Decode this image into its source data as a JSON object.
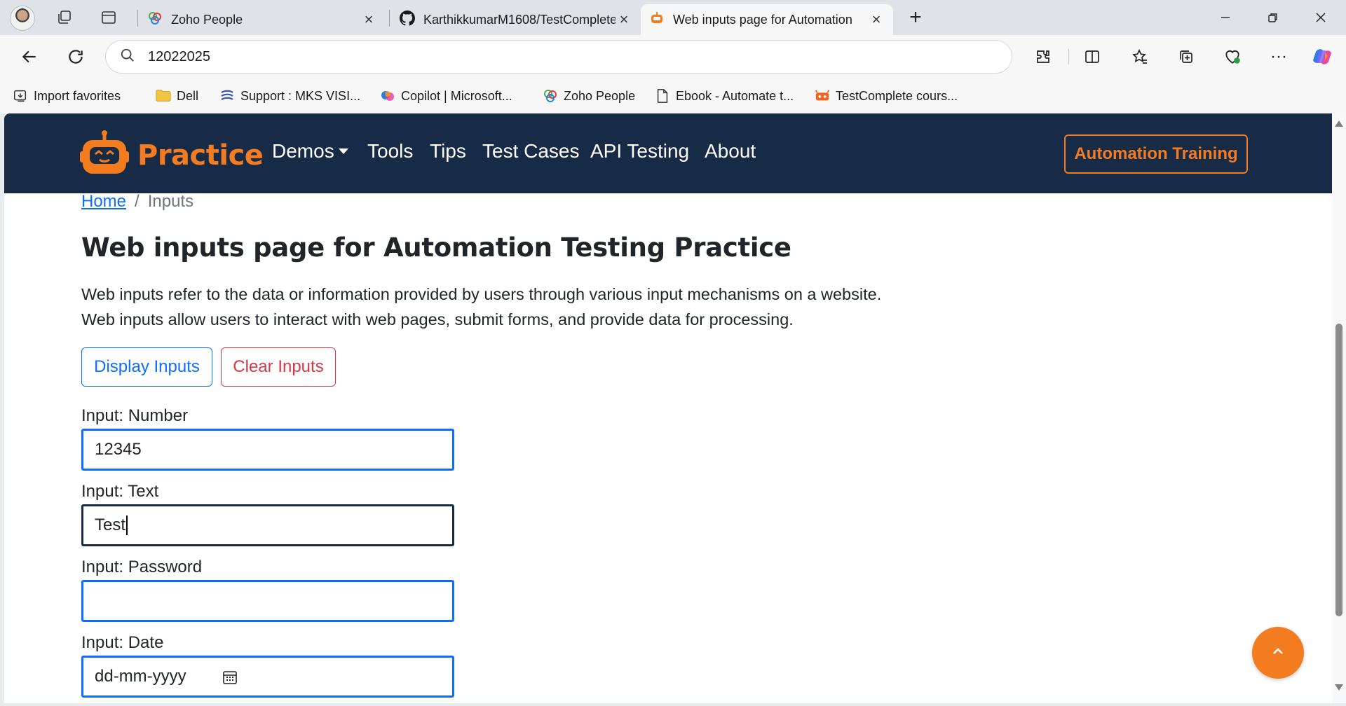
{
  "browser": {
    "tabs": [
      {
        "title": "Zoho People",
        "active": false
      },
      {
        "title": "KarthikkumarM1608/TestComplete",
        "active": false
      },
      {
        "title": "Web inputs page for Automation",
        "active": true
      }
    ],
    "new_tab_icon": "plus-icon",
    "address": "12022025",
    "favorites": [
      {
        "label": "Import favorites",
        "icon": "import-icon"
      },
      {
        "label": "Dell",
        "icon": "folder-icon"
      },
      {
        "label": "Support : MKS VISI...",
        "icon": "mks-logo-icon"
      },
      {
        "label": "Copilot | Microsoft...",
        "icon": "copilot-icon"
      },
      {
        "label": "Zoho People",
        "icon": "zoho-icon"
      },
      {
        "label": "Ebook - Automate t...",
        "icon": "page-icon"
      },
      {
        "label": "TestComplete cours...",
        "icon": "testcomplete-icon"
      }
    ]
  },
  "site": {
    "brand": "Practice",
    "nav": {
      "demos": "Demos",
      "tools": "Tools",
      "tips": "Tips",
      "test_cases": "Test Cases",
      "api_testing": "API Testing",
      "about": "About"
    },
    "cta": "Automation Training",
    "colors": {
      "navbar": "#172a46",
      "accent": "#f47c20",
      "primary": "#0d6efd",
      "danger": "#dc3545"
    }
  },
  "breadcrumb": {
    "home": "Home",
    "separator": "/",
    "current": "Inputs"
  },
  "main": {
    "title": "Web inputs page for Automation Testing Practice",
    "intro_line1": "Web inputs refer to the data or information provided by users through various input mechanisms on a website.",
    "intro_line2": "Web inputs allow users to interact with web pages, submit forms, and provide data for processing.",
    "display_button": "Display Inputs",
    "clear_button": "Clear Inputs",
    "fields": {
      "number": {
        "label": "Input: Number",
        "value": "12345"
      },
      "text": {
        "label": "Input: Text",
        "value": "Test"
      },
      "password": {
        "label": "Input: Password",
        "value": ""
      },
      "date": {
        "label": "Input: Date",
        "placeholder": "dd-mm-yyyy"
      }
    }
  }
}
